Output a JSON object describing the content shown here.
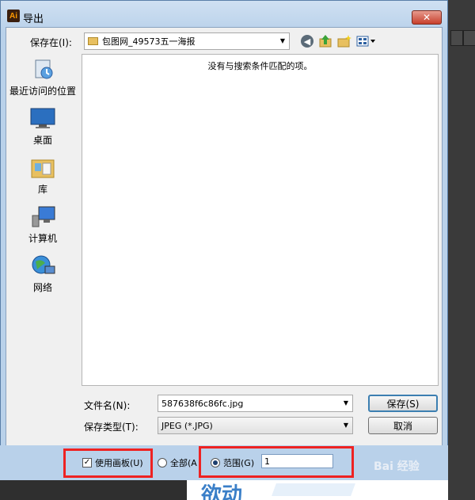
{
  "dialog": {
    "title": "导出",
    "app_icon": "Ai",
    "close_symbol": "✕"
  },
  "save_in": {
    "label": "保存在(I):",
    "folder": "包图网_49573五一海报"
  },
  "toolbar_icons": [
    "back-icon",
    "up-folder-icon",
    "new-folder-icon",
    "view-menu-icon"
  ],
  "places": [
    {
      "label": "最近访问的位置",
      "icon": "recent-places-icon"
    },
    {
      "label": "桌面",
      "icon": "desktop-icon"
    },
    {
      "label": "库",
      "icon": "libraries-icon"
    },
    {
      "label": "计算机",
      "icon": "computer-icon"
    },
    {
      "label": "网络",
      "icon": "network-icon"
    }
  ],
  "file_list": {
    "empty_message": "没有与搜索条件匹配的项。"
  },
  "file_name": {
    "label": "文件名(N):",
    "value": "587638f6c86fc.jpg"
  },
  "save_type": {
    "label": "保存类型(T):",
    "value": "JPEG (*.JPG)"
  },
  "buttons": {
    "save": "保存(S)",
    "cancel": "取消"
  },
  "options": {
    "use_artboards": {
      "label": "使用画板(U)",
      "checked": true
    },
    "all": {
      "label": "全部(A",
      "selected": false
    },
    "range": {
      "label": "范围(G)",
      "selected": true,
      "value": "1"
    }
  },
  "watermark": "Bai 经验",
  "preview_text": "欲动"
}
